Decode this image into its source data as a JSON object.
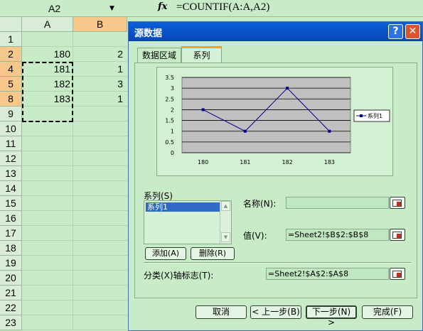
{
  "formula_bar": {
    "name_box": "A2",
    "fx_label": "fx",
    "formula": "=COUNTIF(A:A,A2)"
  },
  "sheet": {
    "columns": [
      "A",
      "B"
    ],
    "rows": [
      {
        "num": "1",
        "a": "",
        "b": ""
      },
      {
        "num": "2",
        "a": "180",
        "b": "2"
      },
      {
        "num": "4",
        "a": "181",
        "b": "1"
      },
      {
        "num": "5",
        "a": "182",
        "b": "3"
      },
      {
        "num": "8",
        "a": "183",
        "b": "1"
      },
      {
        "num": "9",
        "a": "",
        "b": ""
      },
      {
        "num": "10",
        "a": "",
        "b": ""
      },
      {
        "num": "11",
        "a": "",
        "b": ""
      },
      {
        "num": "12",
        "a": "",
        "b": ""
      },
      {
        "num": "13",
        "a": "",
        "b": ""
      },
      {
        "num": "14",
        "a": "",
        "b": ""
      },
      {
        "num": "15",
        "a": "",
        "b": ""
      },
      {
        "num": "16",
        "a": "",
        "b": ""
      },
      {
        "num": "17",
        "a": "",
        "b": ""
      },
      {
        "num": "18",
        "a": "",
        "b": ""
      },
      {
        "num": "19",
        "a": "",
        "b": ""
      },
      {
        "num": "20",
        "a": "",
        "b": ""
      },
      {
        "num": "21",
        "a": "",
        "b": ""
      },
      {
        "num": "22",
        "a": "",
        "b": ""
      },
      {
        "num": "23",
        "a": "",
        "b": ""
      }
    ]
  },
  "dialog": {
    "title": "源数据",
    "help": "?",
    "close": "✕",
    "tabs": [
      "数据区域",
      "系列"
    ],
    "series_label": "系列(S)",
    "series_items": [
      "系列1"
    ],
    "add_button": "添加(A)",
    "remove_button": "删除(R)",
    "name_label": "名称(N):",
    "name_value": "",
    "values_label": "值(V):",
    "values_value": "=Sheet2!$B$2:$B$8",
    "category_label": "分类(X)轴标志(T):",
    "category_value": "=Sheet2!$A$2:$A$8",
    "buttons": {
      "cancel": "取消",
      "back": "< 上一步(B)",
      "next": "下一步(N) >",
      "finish": "完成(F)"
    }
  },
  "chart_data": {
    "type": "line",
    "categories": [
      "180",
      "181",
      "182",
      "183"
    ],
    "series": [
      {
        "name": "系列1",
        "values": [
          2,
          1,
          3,
          1
        ]
      }
    ],
    "ylim": [
      0,
      3.5
    ],
    "yticks": [
      "0",
      "0.5",
      "1",
      "1.5",
      "2",
      "2.5",
      "3",
      "3.5"
    ],
    "grid": true,
    "legend": "right",
    "line_color": "#00008b",
    "plot_color": "#c0c0c0"
  }
}
